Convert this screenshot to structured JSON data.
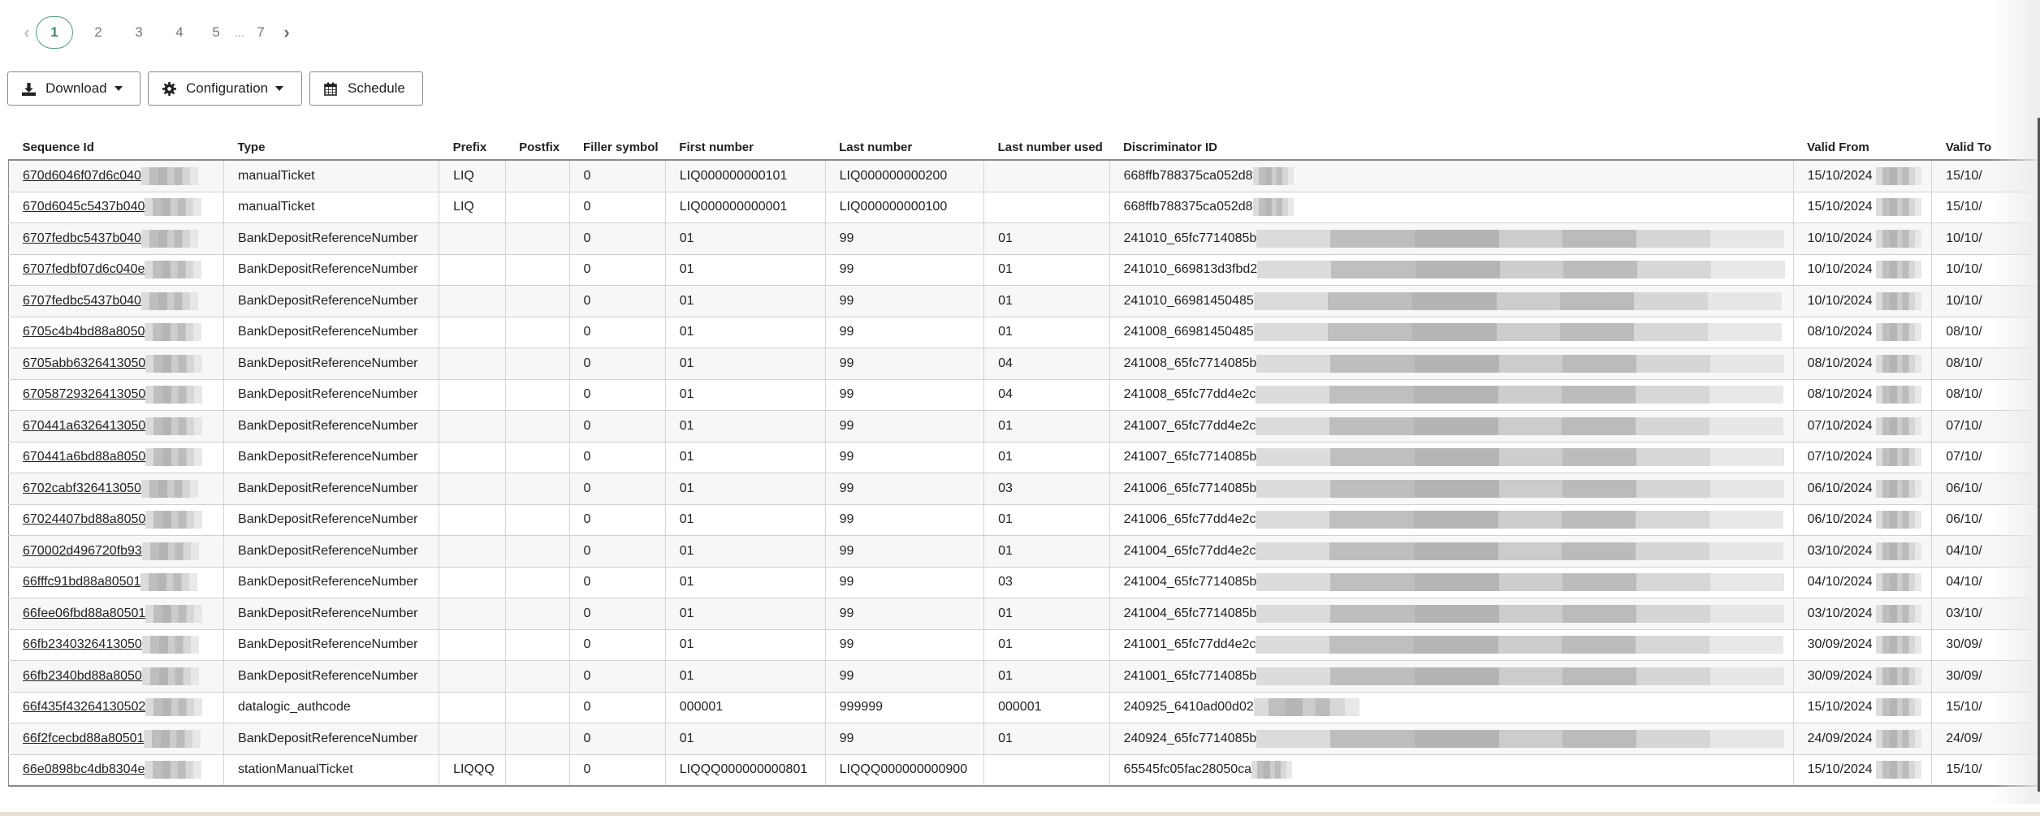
{
  "pagination": {
    "prev_icon": "chevron-left-icon",
    "next_icon": "chevron-right-icon",
    "pages": [
      "1",
      "2",
      "3",
      "4",
      "5"
    ],
    "ellipsis": "...",
    "last_page": "7",
    "current_page": "1",
    "active_color": "#4a9e74"
  },
  "toolbar": {
    "download_label": "Download",
    "download_icon": "download-icon",
    "configuration_label": "Configuration",
    "configuration_icon": "gear-icon",
    "schedule_label": "Schedule",
    "schedule_icon": "calendar-icon"
  },
  "table": {
    "columns": [
      "Sequence Id",
      "Type",
      "Prefix",
      "Postfix",
      "Filler symbol",
      "First number",
      "Last number",
      "Last number used",
      "Discriminator ID",
      "Valid From",
      "Valid To"
    ],
    "rows": [
      {
        "sequence_id": "670d6046f07d6c040",
        "type": "manualTicket",
        "prefix": "LIQ",
        "postfix": "",
        "filler": "0",
        "first": "LIQ000000000101",
        "last": "LIQ000000000200",
        "last_used": "",
        "discriminator": "668ffb788375ca052d8",
        "valid_from": "15/10/2024",
        "valid_to": "15/10/"
      },
      {
        "sequence_id": "670d6045c5437b040",
        "type": "manualTicket",
        "prefix": "LIQ",
        "postfix": "",
        "filler": "0",
        "first": "LIQ000000000001",
        "last": "LIQ000000000100",
        "last_used": "",
        "discriminator": "668ffb788375ca052d8",
        "valid_from": "15/10/2024",
        "valid_to": "15/10/"
      },
      {
        "sequence_id": "6707fedbc5437b040",
        "type": "BankDepositReferenceNumber",
        "prefix": "",
        "postfix": "",
        "filler": "0",
        "first": "01",
        "last": "99",
        "last_used": "01",
        "discriminator": "241010_65fc7714085b",
        "valid_from": "10/10/2024",
        "valid_to": "10/10/"
      },
      {
        "sequence_id": "6707fedbf07d6c040e",
        "type": "BankDepositReferenceNumber",
        "prefix": "",
        "postfix": "",
        "filler": "0",
        "first": "01",
        "last": "99",
        "last_used": "01",
        "discriminator": "241010_669813d3fbd2",
        "valid_from": "10/10/2024",
        "valid_to": "10/10/"
      },
      {
        "sequence_id": "6707fedbc5437b040",
        "type": "BankDepositReferenceNumber",
        "prefix": "",
        "postfix": "",
        "filler": "0",
        "first": "01",
        "last": "99",
        "last_used": "01",
        "discriminator": "241010_66981450485",
        "valid_from": "10/10/2024",
        "valid_to": "10/10/"
      },
      {
        "sequence_id": "6705c4b4bd88a8050",
        "type": "BankDepositReferenceNumber",
        "prefix": "",
        "postfix": "",
        "filler": "0",
        "first": "01",
        "last": "99",
        "last_used": "01",
        "discriminator": "241008_66981450485",
        "valid_from": "08/10/2024",
        "valid_to": "08/10/"
      },
      {
        "sequence_id": "6705abb6326413050",
        "type": "BankDepositReferenceNumber",
        "prefix": "",
        "postfix": "",
        "filler": "0",
        "first": "01",
        "last": "99",
        "last_used": "04",
        "discriminator": "241008_65fc7714085b",
        "valid_from": "08/10/2024",
        "valid_to": "08/10/"
      },
      {
        "sequence_id": "67058729326413050",
        "type": "BankDepositReferenceNumber",
        "prefix": "",
        "postfix": "",
        "filler": "0",
        "first": "01",
        "last": "99",
        "last_used": "04",
        "discriminator": "241008_65fc77dd4e2c",
        "valid_from": "08/10/2024",
        "valid_to": "08/10/"
      },
      {
        "sequence_id": "670441a6326413050",
        "type": "BankDepositReferenceNumber",
        "prefix": "",
        "postfix": "",
        "filler": "0",
        "first": "01",
        "last": "99",
        "last_used": "01",
        "discriminator": "241007_65fc77dd4e2c",
        "valid_from": "07/10/2024",
        "valid_to": "07/10/"
      },
      {
        "sequence_id": "670441a6bd88a8050",
        "type": "BankDepositReferenceNumber",
        "prefix": "",
        "postfix": "",
        "filler": "0",
        "first": "01",
        "last": "99",
        "last_used": "01",
        "discriminator": "241007_65fc7714085b",
        "valid_from": "07/10/2024",
        "valid_to": "07/10/"
      },
      {
        "sequence_id": "6702cabf326413050",
        "type": "BankDepositReferenceNumber",
        "prefix": "",
        "postfix": "",
        "filler": "0",
        "first": "01",
        "last": "99",
        "last_used": "03",
        "discriminator": "241006_65fc7714085b",
        "valid_from": "06/10/2024",
        "valid_to": "06/10/"
      },
      {
        "sequence_id": "67024407bd88a8050",
        "type": "BankDepositReferenceNumber",
        "prefix": "",
        "postfix": "",
        "filler": "0",
        "first": "01",
        "last": "99",
        "last_used": "01",
        "discriminator": "241006_65fc77dd4e2c",
        "valid_from": "06/10/2024",
        "valid_to": "06/10/"
      },
      {
        "sequence_id": "670002d496720fb93",
        "type": "BankDepositReferenceNumber",
        "prefix": "",
        "postfix": "",
        "filler": "0",
        "first": "01",
        "last": "99",
        "last_used": "01",
        "discriminator": "241004_65fc77dd4e2c",
        "valid_from": "03/10/2024",
        "valid_to": "04/10/"
      },
      {
        "sequence_id": "66fffc91bd88a80501",
        "type": "BankDepositReferenceNumber",
        "prefix": "",
        "postfix": "",
        "filler": "0",
        "first": "01",
        "last": "99",
        "last_used": "03",
        "discriminator": "241004_65fc7714085b",
        "valid_from": "04/10/2024",
        "valid_to": "04/10/"
      },
      {
        "sequence_id": "66fee06fbd88a80501",
        "type": "BankDepositReferenceNumber",
        "prefix": "",
        "postfix": "",
        "filler": "0",
        "first": "01",
        "last": "99",
        "last_used": "01",
        "discriminator": "241004_65fc7714085b",
        "valid_from": "03/10/2024",
        "valid_to": "03/10/"
      },
      {
        "sequence_id": "66fb2340326413050",
        "type": "BankDepositReferenceNumber",
        "prefix": "",
        "postfix": "",
        "filler": "0",
        "first": "01",
        "last": "99",
        "last_used": "01",
        "discriminator": "241001_65fc77dd4e2c",
        "valid_from": "30/09/2024",
        "valid_to": "30/09/"
      },
      {
        "sequence_id": "66fb2340bd88a8050",
        "type": "BankDepositReferenceNumber",
        "prefix": "",
        "postfix": "",
        "filler": "0",
        "first": "01",
        "last": "99",
        "last_used": "01",
        "discriminator": "241001_65fc7714085b",
        "valid_from": "30/09/2024",
        "valid_to": "30/09/"
      },
      {
        "sequence_id": "66f435f43264130502",
        "type": "datalogic_authcode",
        "prefix": "",
        "postfix": "",
        "filler": "0",
        "first": "000001",
        "last": "999999",
        "last_used": "000001",
        "discriminator": "240925_6410ad00d02",
        "valid_from": "15/10/2024",
        "valid_to": "15/10/"
      },
      {
        "sequence_id": "66f2fcecbd88a80501",
        "type": "BankDepositReferenceNumber",
        "prefix": "",
        "postfix": "",
        "filler": "0",
        "first": "01",
        "last": "99",
        "last_used": "01",
        "discriminator": "240924_65fc7714085b",
        "valid_from": "24/09/2024",
        "valid_to": "24/09/"
      },
      {
        "sequence_id": "66e0898bc4db8304e",
        "type": "stationManualTicket",
        "prefix": "LIQQQ",
        "postfix": "",
        "filler": "0",
        "first": "LIQQQ000000000801",
        "last": "LIQQQ000000000900",
        "last_used": "",
        "discriminator": "65545fc05fac28050ca",
        "valid_from": "15/10/2024",
        "valid_to": "15/10/"
      }
    ]
  }
}
